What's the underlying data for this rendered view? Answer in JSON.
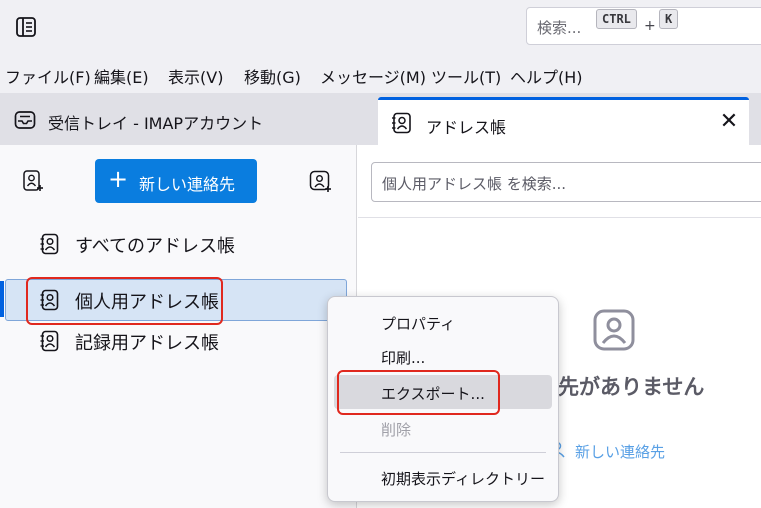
{
  "toolbar": {
    "search_placeholder": "検索...",
    "shortcut_key1": "CTRL",
    "shortcut_plus": "+",
    "shortcut_key2": "K"
  },
  "menubar": {
    "items": [
      "ファイル(F)",
      "編集(E)",
      "表示(V)",
      "移動(G)",
      "メッセージ(M)",
      "ツール(T)",
      "ヘルプ(H)"
    ]
  },
  "tabs": {
    "mail": "受信トレイ - IMAPアカウント",
    "addressbook": "アドレス帳",
    "close_glyph": "✕"
  },
  "sidebar": {
    "new_contact_plus": "+",
    "new_contact_label": "新しい連絡先",
    "books": [
      "すべてのアドレス帳",
      "個人用アドレス帳",
      "記録用アドレス帳"
    ],
    "selected_index": 1
  },
  "main": {
    "search_placeholder": "個人用アドレス帳 を検索...",
    "empty_text": "先がありません",
    "empty_link": "新しい連絡先"
  },
  "context_menu": {
    "items": [
      "プロパティ",
      "印刷...",
      "エクスポート...",
      "削除",
      "初期表示ディレクトリー"
    ],
    "hovered_index": 2,
    "disabled_index": 3
  },
  "colors": {
    "accent": "#0061e0",
    "button": "#0a7ddf",
    "highlight": "#e0281e",
    "selected_row": "#d6e4f5"
  }
}
